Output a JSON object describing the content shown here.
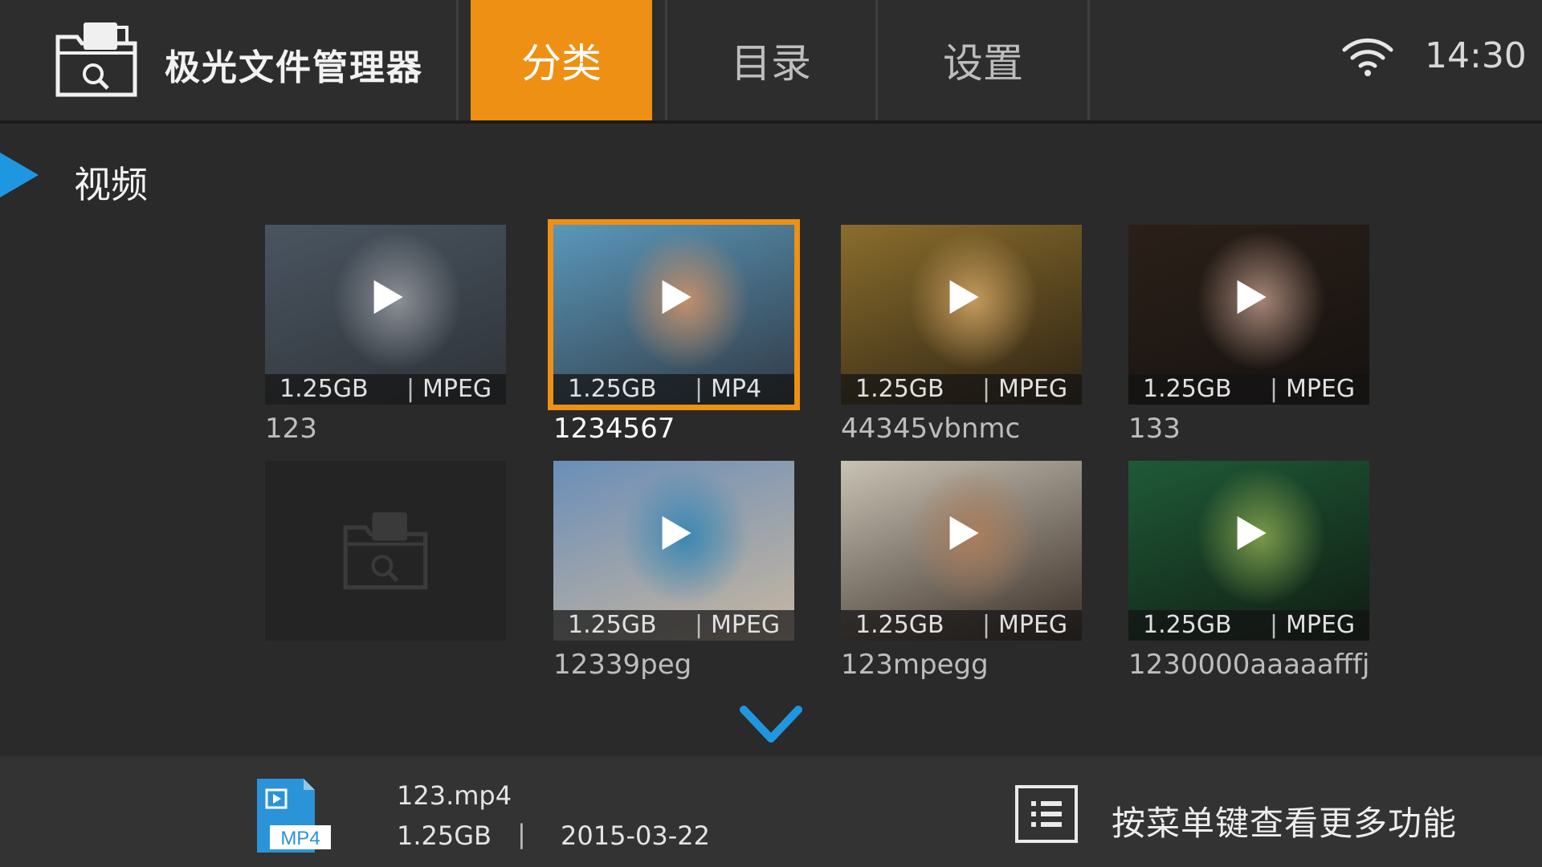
{
  "header": {
    "app_title": "极光文件管理器",
    "tabs": [
      {
        "label": "分类",
        "active": true
      },
      {
        "label": "目录",
        "active": false
      },
      {
        "label": "设置",
        "active": false
      }
    ],
    "time": "14:30",
    "wifi_icon": "wifi-icon"
  },
  "section": {
    "title": "视频"
  },
  "videos": [
    {
      "name": "123",
      "size": "1.25GB",
      "format": "MPEG",
      "thumb_colors": [
        "#4a5560",
        "#8b8f96",
        "#2e3238"
      ]
    },
    {
      "name": "1234567",
      "size": "1.25GB",
      "format": "MP4",
      "selected": true,
      "thumb_colors": [
        "#5a97b9",
        "#c28f6a",
        "#303944"
      ]
    },
    {
      "name": "44345vbnmc",
      "size": "1.25GB",
      "format": "MPEG",
      "thumb_colors": [
        "#8a6d2c",
        "#c49a5c",
        "#2d2314"
      ]
    },
    {
      "name": "133",
      "size": "1.25GB",
      "format": "MPEG",
      "thumb_colors": [
        "#2b2019",
        "#a48576",
        "#161210"
      ]
    },
    {
      "name": "",
      "size": "",
      "format": "",
      "placeholder": true
    },
    {
      "name": "12339peg",
      "size": "1.25GB",
      "format": "MPEG",
      "thumb_colors": [
        "#6a8eb8",
        "#3a88b3",
        "#c9b7a0"
      ]
    },
    {
      "name": "123mpegg",
      "size": "1.25GB",
      "format": "MPEG",
      "thumb_colors": [
        "#c8c2b4",
        "#a97d5c",
        "#3a2e26"
      ]
    },
    {
      "name": "1230000aaaaafffj…",
      "size": "1.25GB",
      "format": "MPEG",
      "thumb_colors": [
        "#1f5a37",
        "#7a9a4a",
        "#101c12"
      ]
    }
  ],
  "footer": {
    "file_icon_label": "MP4",
    "file_name": "123.mp4",
    "file_size": "1.25GB",
    "separator": "|",
    "file_date": "2015-03-22",
    "menu_hint": "按菜单键查看更多功能"
  },
  "colors": {
    "accent": "#ed9014",
    "section_marker": "#1f97e0",
    "scroll_arrow": "#1f97e0"
  }
}
